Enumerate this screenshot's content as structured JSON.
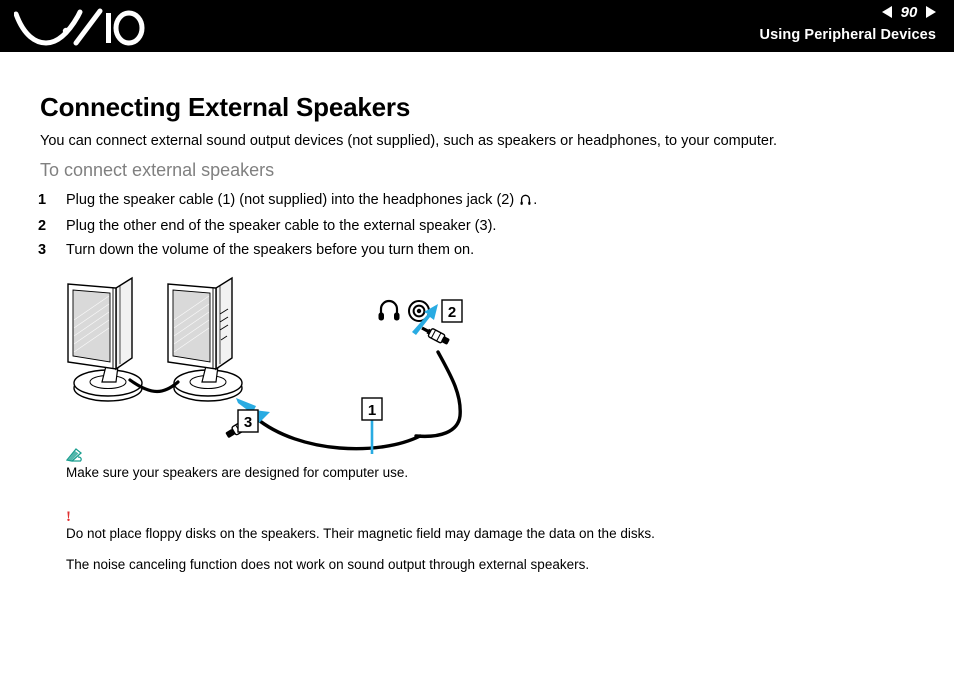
{
  "header": {
    "logo_name": "vaio-logo",
    "page_number": "90",
    "prev_icon": "triangle-left-icon",
    "next_icon": "triangle-right-icon",
    "section_title": "Using Peripheral Devices",
    "background_color": "#000000",
    "text_color": "#ffffff"
  },
  "main": {
    "heading": "Connecting External Speakers",
    "intro": "You can connect external sound output devices (not supplied), such as speakers or headphones, to your computer.",
    "subheading": "To connect external speakers",
    "subheading_color": "#808080",
    "steps": [
      {
        "number": "1",
        "text_before": "Plug the speaker cable (1) (not supplied) into the headphones jack (2) ",
        "icon": "headphones-icon",
        "text_after": "."
      },
      {
        "number": "2",
        "text_before": "Plug the other end of the speaker cable to the external speaker (3).",
        "icon": "",
        "text_after": ""
      },
      {
        "number": "3",
        "text_before": "Turn down the volume of the speakers before you turn them on.",
        "icon": "",
        "text_after": ""
      }
    ]
  },
  "figure": {
    "name": "speaker-connection-diagram",
    "accent_color": "#29abe2",
    "callouts": [
      {
        "label": "1",
        "target": "speaker-cable"
      },
      {
        "label": "2",
        "target": "headphones-jack"
      },
      {
        "label": "3",
        "target": "external-speaker"
      }
    ],
    "jack_icons": [
      {
        "name": "headphones-icon"
      },
      {
        "name": "audio-jack-port-icon"
      }
    ],
    "parts": [
      "left-speaker",
      "right-speaker",
      "speaker-link-cable",
      "speaker-plug",
      "jack-plug"
    ]
  },
  "notes": [
    {
      "icon": "pencil-note-icon",
      "icon_color": "#1a9e8f",
      "icon_glyph": "",
      "text": "Make sure your speakers are designed for computer use."
    },
    {
      "icon": "exclamation-warning-icon",
      "icon_color": "#e03131",
      "icon_glyph": "!",
      "text": "Do not place floppy disks on the speakers. Their magnetic field may damage the data on the disks."
    },
    {
      "icon": "",
      "icon_color": "",
      "icon_glyph": "",
      "text": "The noise canceling function does not work on sound output through external speakers."
    }
  ]
}
